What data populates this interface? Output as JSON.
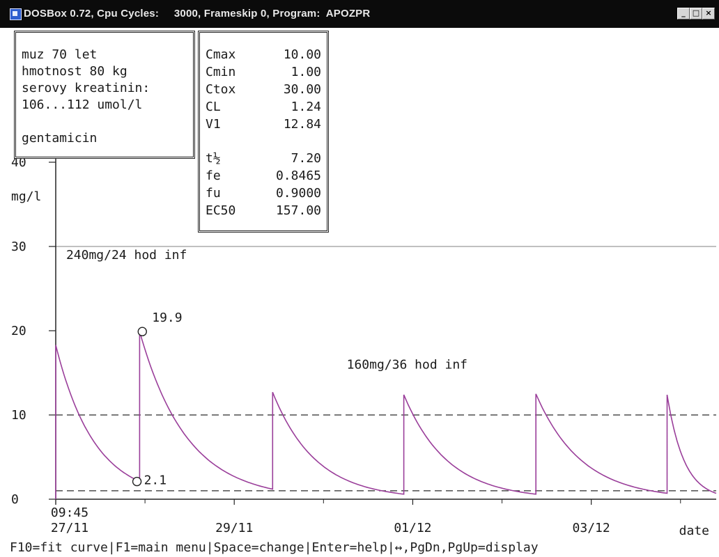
{
  "window": {
    "title": "DOSBox 0.72, Cpu Cycles:     3000, Frameskip 0, Program:  APOZPR",
    "buttons": [
      "_",
      "□",
      "×"
    ]
  },
  "patient": {
    "lines": [
      "muz 70 let",
      "hmotnost 80 kg",
      "serovy kreatinin:",
      "106...112 umol/l",
      "",
      "gentamicin"
    ]
  },
  "parameters": [
    {
      "name": "Cmax",
      "value": "10.00"
    },
    {
      "name": "Cmin",
      "value": "1.00"
    },
    {
      "name": "Ctox",
      "value": "30.00"
    },
    {
      "name": "CL",
      "value": "1.24"
    },
    {
      "name": "V1",
      "value": "12.84"
    },
    {
      "name": "t½",
      "value": "7.20"
    },
    {
      "name": "fe",
      "value": "0.8465"
    },
    {
      "name": "fu",
      "value": "0.9000"
    },
    {
      "name": "EC50",
      "value": "157.00"
    }
  ],
  "chart_data": {
    "type": "line",
    "ylabel": "mg/l",
    "xlabel": "date",
    "y_ticks": [
      "0",
      "10",
      "20",
      "30",
      "40"
    ],
    "x_ticks": [
      {
        "label": "09:45",
        "day": 0
      },
      {
        "label": "27/11",
        "day": 0
      },
      {
        "label": "29/11",
        "day": 2
      },
      {
        "label": "01/12",
        "day": 4
      },
      {
        "label": "03/12",
        "day": 6
      }
    ],
    "x_range_days": [
      0,
      7.4
    ],
    "ylim": [
      0,
      40
    ],
    "reference_lines": [
      {
        "name": "Cmax",
        "y": 10,
        "style": "dashed"
      },
      {
        "name": "Cmin",
        "y": 1,
        "style": "dashed"
      },
      {
        "name": "Ctox",
        "y": 30,
        "style": "solid"
      }
    ],
    "series": [
      {
        "color": "#9a3e9a",
        "doses": [
          {
            "start": 0.0,
            "peak": 18.3,
            "trough": 2.1,
            "end": 0.94
          },
          {
            "start": 0.94,
            "peak": 19.9,
            "trough": 1.2,
            "end": 2.43
          },
          {
            "start": 2.43,
            "peak": 12.7,
            "trough": 0.6,
            "end": 3.9
          },
          {
            "start": 3.9,
            "peak": 12.4,
            "trough": 0.6,
            "end": 5.38
          },
          {
            "start": 5.38,
            "peak": 12.5,
            "trough": 0.7,
            "end": 6.85
          },
          {
            "start": 6.85,
            "peak": 12.4,
            "trough": 0.7,
            "end": 7.4
          }
        ],
        "measured_points": [
          {
            "day": 0.91,
            "y": 2.1,
            "label": "2.1"
          },
          {
            "day": 0.97,
            "y": 19.9,
            "label": "19.9"
          }
        ]
      }
    ],
    "annotations": [
      {
        "text": "240mg/24 hod inf",
        "day": 0.07,
        "y": 29
      },
      {
        "text": "160mg/36 hod inf",
        "day": 3.26,
        "y": 16
      }
    ]
  },
  "statusbar": {
    "text": "F10=fit curve|F1=main menu|Space=change|Enter=help|↔,PgDn,PgUp=display"
  }
}
